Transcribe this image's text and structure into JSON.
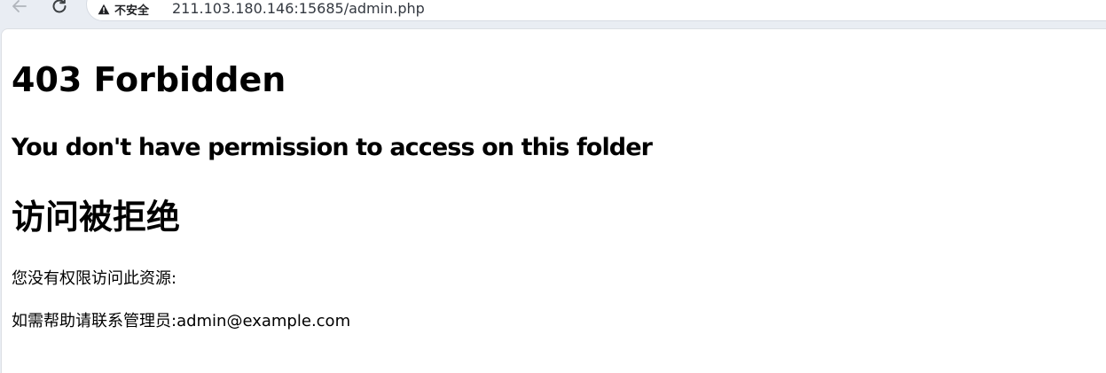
{
  "browser": {
    "security_label": "不安全",
    "url": "211.103.180.146:15685/admin.php"
  },
  "page": {
    "heading": "403 Forbidden",
    "subheading": "You don't have permission to access on this folder",
    "heading_cn": "访问被拒绝",
    "message_line1": "您没有权限访问此资源:",
    "message_line2": "如需帮助请联系管理员:admin@example.com"
  },
  "icons": {
    "back": "arrow-left-icon",
    "reload": "reload-icon",
    "security": "warning-triangle-icon"
  }
}
